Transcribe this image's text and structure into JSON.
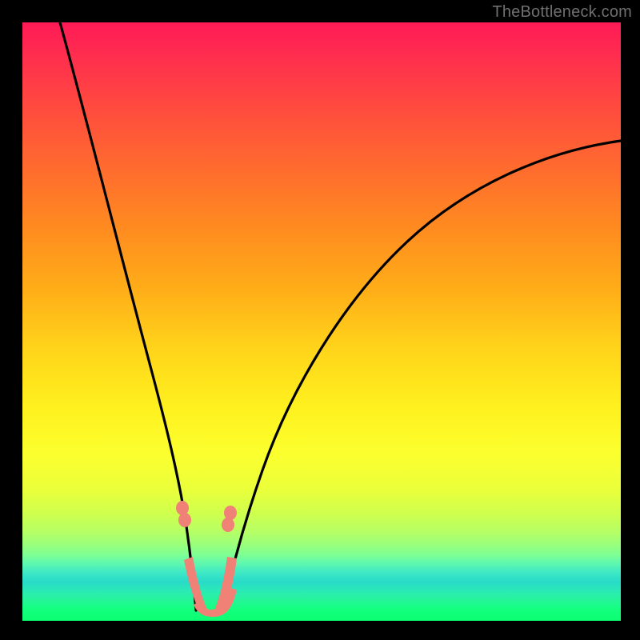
{
  "watermark": "TheBottleneck.com",
  "colors": {
    "frame_bg": "#000000",
    "curve_stroke": "#000000",
    "blob_fill": "#ef8176",
    "watermark_text": "#6f6f6f"
  },
  "chart_data": {
    "type": "line",
    "title": "",
    "xlabel": "",
    "ylabel": "",
    "xlim": [
      0,
      100
    ],
    "ylim": [
      0,
      100
    ],
    "grid": false,
    "series": [
      {
        "name": "left-branch",
        "x": [
          6,
          10,
          14,
          18,
          20,
          22,
          24,
          26,
          27,
          28,
          28.5
        ],
        "y": [
          100,
          85,
          68,
          48,
          38,
          28,
          18,
          10,
          5,
          2,
          0
        ]
      },
      {
        "name": "right-branch",
        "x": [
          33,
          34,
          36,
          40,
          46,
          54,
          62,
          72,
          82,
          92,
          100
        ],
        "y": [
          0,
          3,
          8,
          18,
          30,
          42,
          52,
          62,
          70,
          76,
          80
        ]
      }
    ],
    "annotations": [
      {
        "name": "bottom-blob-cluster",
        "approx_x_range": [
          25,
          35
        ],
        "approx_y_range": [
          0,
          10
        ]
      }
    ]
  }
}
